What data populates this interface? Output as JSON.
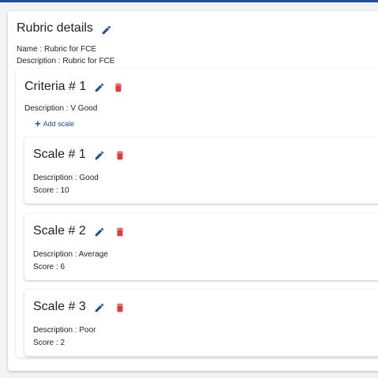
{
  "rubric": {
    "title": "Rubric details",
    "name_line": "Name : Rubric for FCE",
    "description_line": "Description : Rubric for FCE"
  },
  "criteria": {
    "title": "Criteria # 1",
    "description_line": "Description : V Good",
    "add_scale_label": "Add scale"
  },
  "scales": [
    {
      "title": "Scale # 1",
      "description_line": "Description : Good",
      "score_line": "Score : 10"
    },
    {
      "title": "Scale # 2",
      "description_line": "Description : Average",
      "score_line": "Score : 6"
    },
    {
      "title": "Scale # 3",
      "description_line": "Description : Poor",
      "score_line": "Score : 2"
    }
  ],
  "icons": {
    "edit": "pencil-icon",
    "delete": "trash-icon",
    "add": "plus-icon"
  },
  "colors": {
    "accent": "#1e4ea3",
    "delete": "#e53935"
  }
}
